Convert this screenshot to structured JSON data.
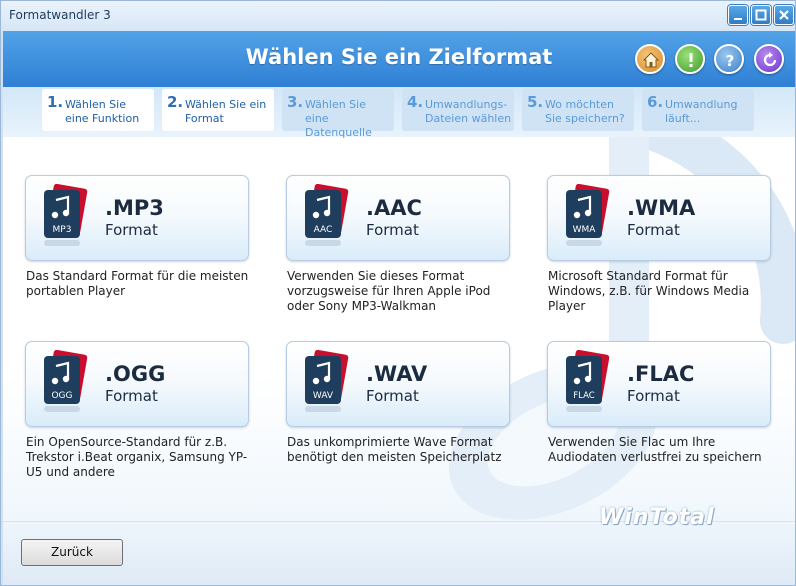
{
  "window": {
    "title": "Formatwandler 3"
  },
  "header": {
    "title": "Wählen Sie ein Zielformat",
    "icons": [
      "home-icon",
      "warning-icon",
      "help-icon",
      "refresh-icon"
    ]
  },
  "steps": [
    {
      "num": "1.",
      "label": "Wählen Sie eine Funktion",
      "state": "active"
    },
    {
      "num": "2.",
      "label": "Wählen Sie ein Format",
      "state": "active"
    },
    {
      "num": "3.",
      "label": "Wählen Sie eine Datenquelle",
      "state": "inactive"
    },
    {
      "num": "4.",
      "label": "Umwandlungs-Dateien wählen",
      "state": "inactive"
    },
    {
      "num": "5.",
      "label": "Wo möchten Sie speichern?",
      "state": "inactive"
    },
    {
      "num": "6.",
      "label": "Umwandlung läuft...",
      "state": "inactive"
    }
  ],
  "formats": [
    {
      "badge": "MP3",
      "ext": ".MP3",
      "word": "Format",
      "desc": "Das Standard Format für die meisten portablen Player"
    },
    {
      "badge": "AAC",
      "ext": ".AAC",
      "word": "Format",
      "desc": "Verwenden Sie dieses Format vorzugsweise für Ihren Apple iPod oder Sony MP3-Walkman"
    },
    {
      "badge": "WMA",
      "ext": ".WMA",
      "word": "Format",
      "desc": "Microsoft Standard Format für Windows, z.B. für Windows Media Player"
    },
    {
      "badge": "OGG",
      "ext": ".OGG",
      "word": "Format",
      "desc": "Ein OpenSource-Standard für z.B. Trekstor i.Beat organix, Samsung YP-U5 und andere"
    },
    {
      "badge": "WAV",
      "ext": ".WAV",
      "word": "Format",
      "desc": "Das unkomprimierte Wave Format benötigt den meisten Speicherplatz"
    },
    {
      "badge": "FLAC",
      "ext": ".FLAC",
      "word": "Format",
      "desc": "Verwenden Sie Flac um Ihre Audiodaten verlustfrei zu speichern"
    }
  ],
  "watermark": "WinTotal",
  "footer": {
    "back_label": "Zurück"
  },
  "colors": {
    "header": "#3a8fdc",
    "accent": "#2f6fb8",
    "badge_red": "#c8102e",
    "badge_dark": "#1f3d5c"
  }
}
